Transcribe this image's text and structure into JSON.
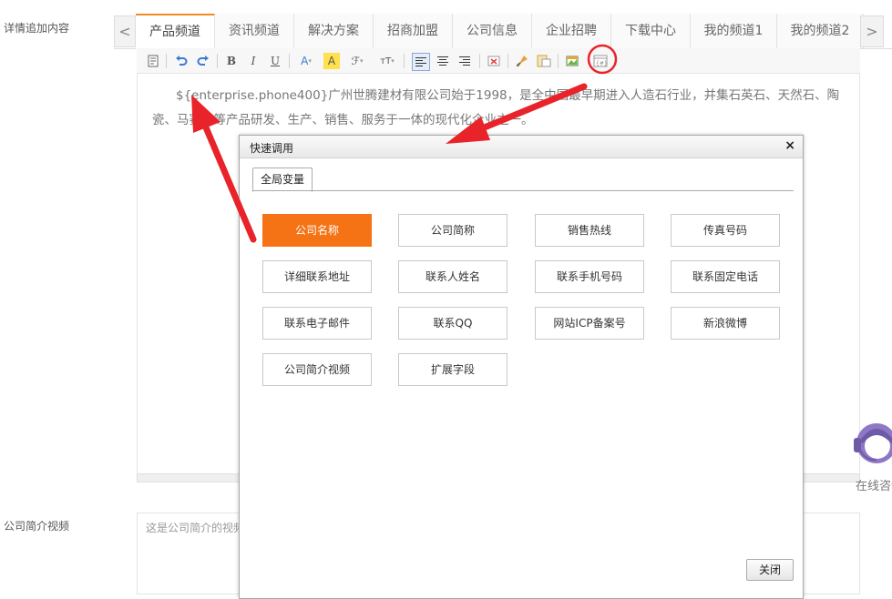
{
  "form": {
    "detail_label": "详情追加内容",
    "video_label": "公司简介视频",
    "video_placeholder": "这是公司简介的视频"
  },
  "tabs": {
    "prev_label": "<",
    "next_label": ">",
    "items": [
      "产品频道",
      "资讯频道",
      "解决方案",
      "招商加盟",
      "公司信息",
      "企业招聘",
      "下载中心",
      "我的频道1",
      "我的频道2"
    ],
    "active": "产品频道"
  },
  "toolbar": {
    "icons": [
      "source-icon",
      "undo-icon",
      "redo-icon",
      "bold-icon",
      "italic-icon",
      "underline-icon",
      "font-color-icon",
      "highlight-icon",
      "font-family-icon",
      "font-size-icon",
      "align-left-icon",
      "align-center-icon",
      "align-right-icon",
      "clear-format-icon",
      "brush-icon",
      "paste-icon",
      "insert-image-icon",
      "quick-insert-icon"
    ],
    "bold": "B",
    "italic": "I",
    "underline": "U",
    "font_color": "A",
    "highlight": "A",
    "font_family": "ℱ",
    "font_size": "тT"
  },
  "editor": {
    "content": "${enterprise.phone400}广州世腾建材有限公司始于1998，是全中国最早期进入人造石行业，并集石英石、天然石、陶瓷、马赛克等产品研发、生产、销售、服务于一体的现代化企业之一。"
  },
  "dialog": {
    "title": "快速调用",
    "close_glyph": "×",
    "tab": "全局变量",
    "buttons": [
      "公司名称",
      "公司简称",
      "销售热线",
      "传真号码",
      "详细联系地址",
      "联系人姓名",
      "联系手机号码",
      "联系固定电话",
      "联系电子邮件",
      "联系QQ",
      "网站ICP备案号",
      "新浪微博",
      "公司简介视频",
      "扩展字段"
    ],
    "active_button": "公司名称",
    "close_button": "关闭"
  },
  "online_service": {
    "label": "在线咨询"
  },
  "colors": {
    "accent": "#f57215",
    "annotation": "#e8242a",
    "tab_active_border": "#f08a24"
  }
}
